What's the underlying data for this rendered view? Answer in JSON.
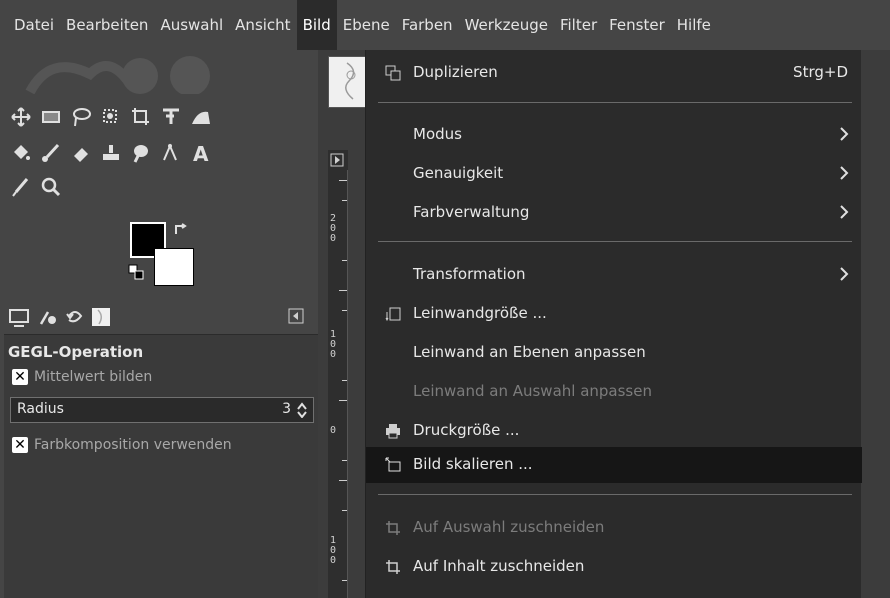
{
  "menubar": {
    "items": [
      "Datei",
      "Bearbeiten",
      "Auswahl",
      "Ansicht",
      "Bild",
      "Ebene",
      "Farben",
      "Werkzeuge",
      "Filter",
      "Fenster",
      "Hilfe"
    ],
    "active": "Bild"
  },
  "tool_options": {
    "title": "GEGL-Operation",
    "average_label": "Mittelwert bilden",
    "radius_label": "Radius",
    "radius_value": "3",
    "color_composition_label": "Farbkomposition verwenden"
  },
  "ruler": {
    "labels_top": [
      "2",
      "0",
      "0"
    ],
    "labels_mid": [
      "1",
      "0",
      "0"
    ],
    "label_zero": "0",
    "labels_bottom": [
      "1",
      "0",
      "0"
    ]
  },
  "bild_menu": {
    "items": [
      {
        "label": "Duplizieren",
        "shortcut": "Strg+D",
        "icon": "duplicate-icon",
        "enabled": true
      },
      {
        "label": "Modus",
        "submenu": true,
        "enabled": true
      },
      {
        "label": "Genauigkeit",
        "submenu": true,
        "enabled": true
      },
      {
        "label": "Farbverwaltung",
        "submenu": true,
        "enabled": true
      },
      {
        "label": "Transformation",
        "submenu": true,
        "enabled": true
      },
      {
        "label": "Leinwandgröße ...",
        "icon": "canvas-size-icon",
        "enabled": true
      },
      {
        "label": "Leinwand an Ebenen anpassen",
        "enabled": true
      },
      {
        "label": "Leinwand an Auswahl anpassen",
        "enabled": false
      },
      {
        "label": "Druckgröße ...",
        "icon": "printer-icon",
        "enabled": true
      },
      {
        "label": "Bild skalieren ...",
        "icon": "scale-image-icon",
        "enabled": true,
        "highlighted": true
      },
      {
        "label": "Auf Auswahl zuschneiden",
        "icon": "crop-icon",
        "enabled": false
      },
      {
        "label": "Auf Inhalt zuschneiden",
        "icon": "crop-icon",
        "enabled": true
      }
    ]
  },
  "colors": {
    "foreground": "#000000",
    "background": "#ffffff",
    "menu_bg": "#2b2b2b",
    "highlight_bg": "#161616",
    "disabled_text": "#7c7c7c"
  }
}
